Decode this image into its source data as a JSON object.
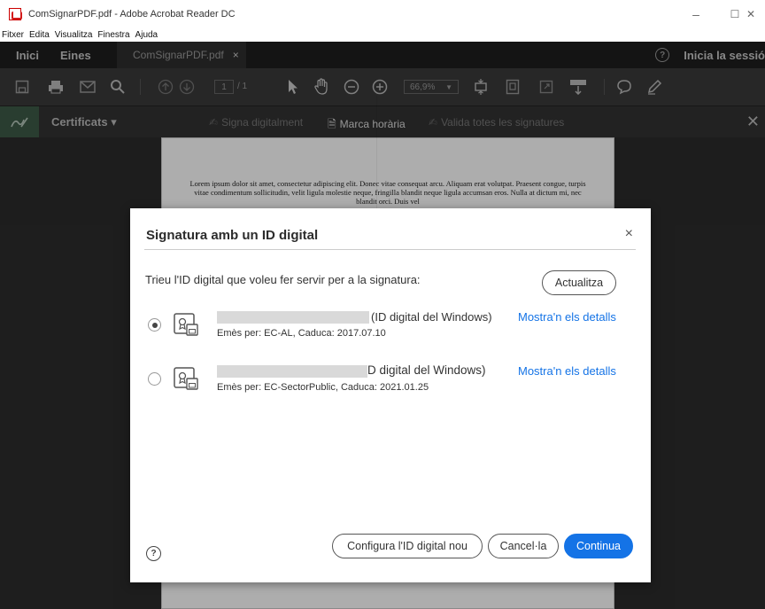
{
  "window": {
    "title": "ComSignarPDF.pdf - Adobe Acrobat Reader DC",
    "minimize_glyph": "–",
    "maximize_glyph": "☐",
    "close_glyph": "✕"
  },
  "menu": [
    "Fitxer",
    "Edita",
    "Visualitza",
    "Finestra",
    "Ajuda"
  ],
  "tabs": {
    "home": "Inici",
    "tools": "Eines",
    "document": "ComSignarPDF.pdf",
    "document_close": "×",
    "help_glyph": "?",
    "sign_in": "Inicia la sessió"
  },
  "toolbar": {
    "page_current": "1",
    "page_total": "/ 1",
    "zoom": "66,9%"
  },
  "cert_bar": {
    "title": "Certificats ▾",
    "sign_digitally": "Signa digitalment",
    "timestamp": "Marca horària",
    "validate_all": "Valida totes les signatures",
    "close_glyph": "✕"
  },
  "document": {
    "text": "Lorem ipsum dolor sit amet, consectetur adipiscing elit. Donec vitae consequat arcu. Aliquam erat volutpat. Praesent congue, turpis vitae condimentum sollicitudin, velit ligula molestie neque, fringilla blandit neque ligula accumsan eros. Nulla at dictum mi, nec blandit orci. Duis vel"
  },
  "dialog": {
    "title": "Signatura amb un ID digital",
    "close_glyph": "×",
    "prompt": "Trieu l'ID digital que voleu fer servir per a la signatura:",
    "refresh_button": "Actualitza",
    "certificates": [
      {
        "selected": true,
        "name_suffix": "(ID digital del Windows)",
        "issuer": "Emès per: EC-AL, Caduca: 2017.07.10",
        "details_link": "Mostra'n els detalls"
      },
      {
        "selected": false,
        "name_suffix": "D digital del Windows)",
        "issuer": "Emès per: EC-SectorPublic, Caduca: 2021.01.25",
        "details_link": "Mostra'n els detalls"
      }
    ],
    "help_glyph": "?",
    "configure_button": "Configura l'ID digital nou",
    "cancel_button": "Cancel·la",
    "continue_button": "Continua"
  },
  "colors": {
    "accent": "#1473e6",
    "toolbar_dark": "#3a3a3a",
    "tabbar": "#1e1e1e"
  }
}
